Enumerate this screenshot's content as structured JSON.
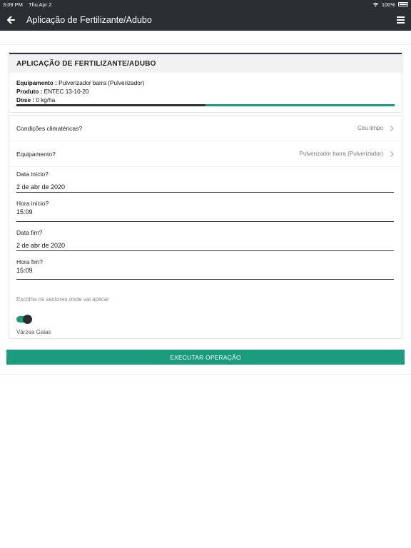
{
  "status_bar": {
    "time": "3:09 PM",
    "date": "Thu Apr 2",
    "battery": "100%",
    "wifi_icon": "wifi-icon"
  },
  "navbar": {
    "title": "Aplicação de Fertilizante/Adubo",
    "back_icon": "arrow-left-icon",
    "menu_icon": "hamburger-menu-icon",
    "background": "#2b2f33"
  },
  "summary": {
    "header": "APLICAÇÃO DE FERTILIZANTE/ADUBO",
    "equipment_label": "Equipamento :",
    "equipment_value": "Pulverizador barra (Pulverizador)",
    "product_label": "Produto :",
    "product_value": "ENTEC 13-10-20",
    "dose_label": "Dose :",
    "dose_value": "0 kg/ha",
    "progress_fraction": 0.5
  },
  "form": {
    "climate": {
      "label": "Condições climatéricas?",
      "value": "Céu limpo"
    },
    "equipment": {
      "label": "Equipamento?",
      "value": "Pulverizador barra (Pulverizador)"
    },
    "start_date": {
      "label": "Data início?",
      "value": "2 de abr de 2020"
    },
    "start_time": {
      "label": "Hora início?",
      "value": "15:09"
    },
    "end_date": {
      "label": "Data fim?",
      "value": "2 de abr de 2020"
    },
    "end_time": {
      "label": "Hora fim?",
      "value": "15:09"
    },
    "sectors_hint": "Escolha os sectores onde vai aplicar",
    "sectors": [
      {
        "name": "Várzea Galas",
        "enabled": true
      }
    ]
  },
  "actions": {
    "execute_label": "EXECUTAR OPERAÇÃO"
  },
  "colors": {
    "accent": "#1a9c7d",
    "dark": "#2b2f33"
  }
}
